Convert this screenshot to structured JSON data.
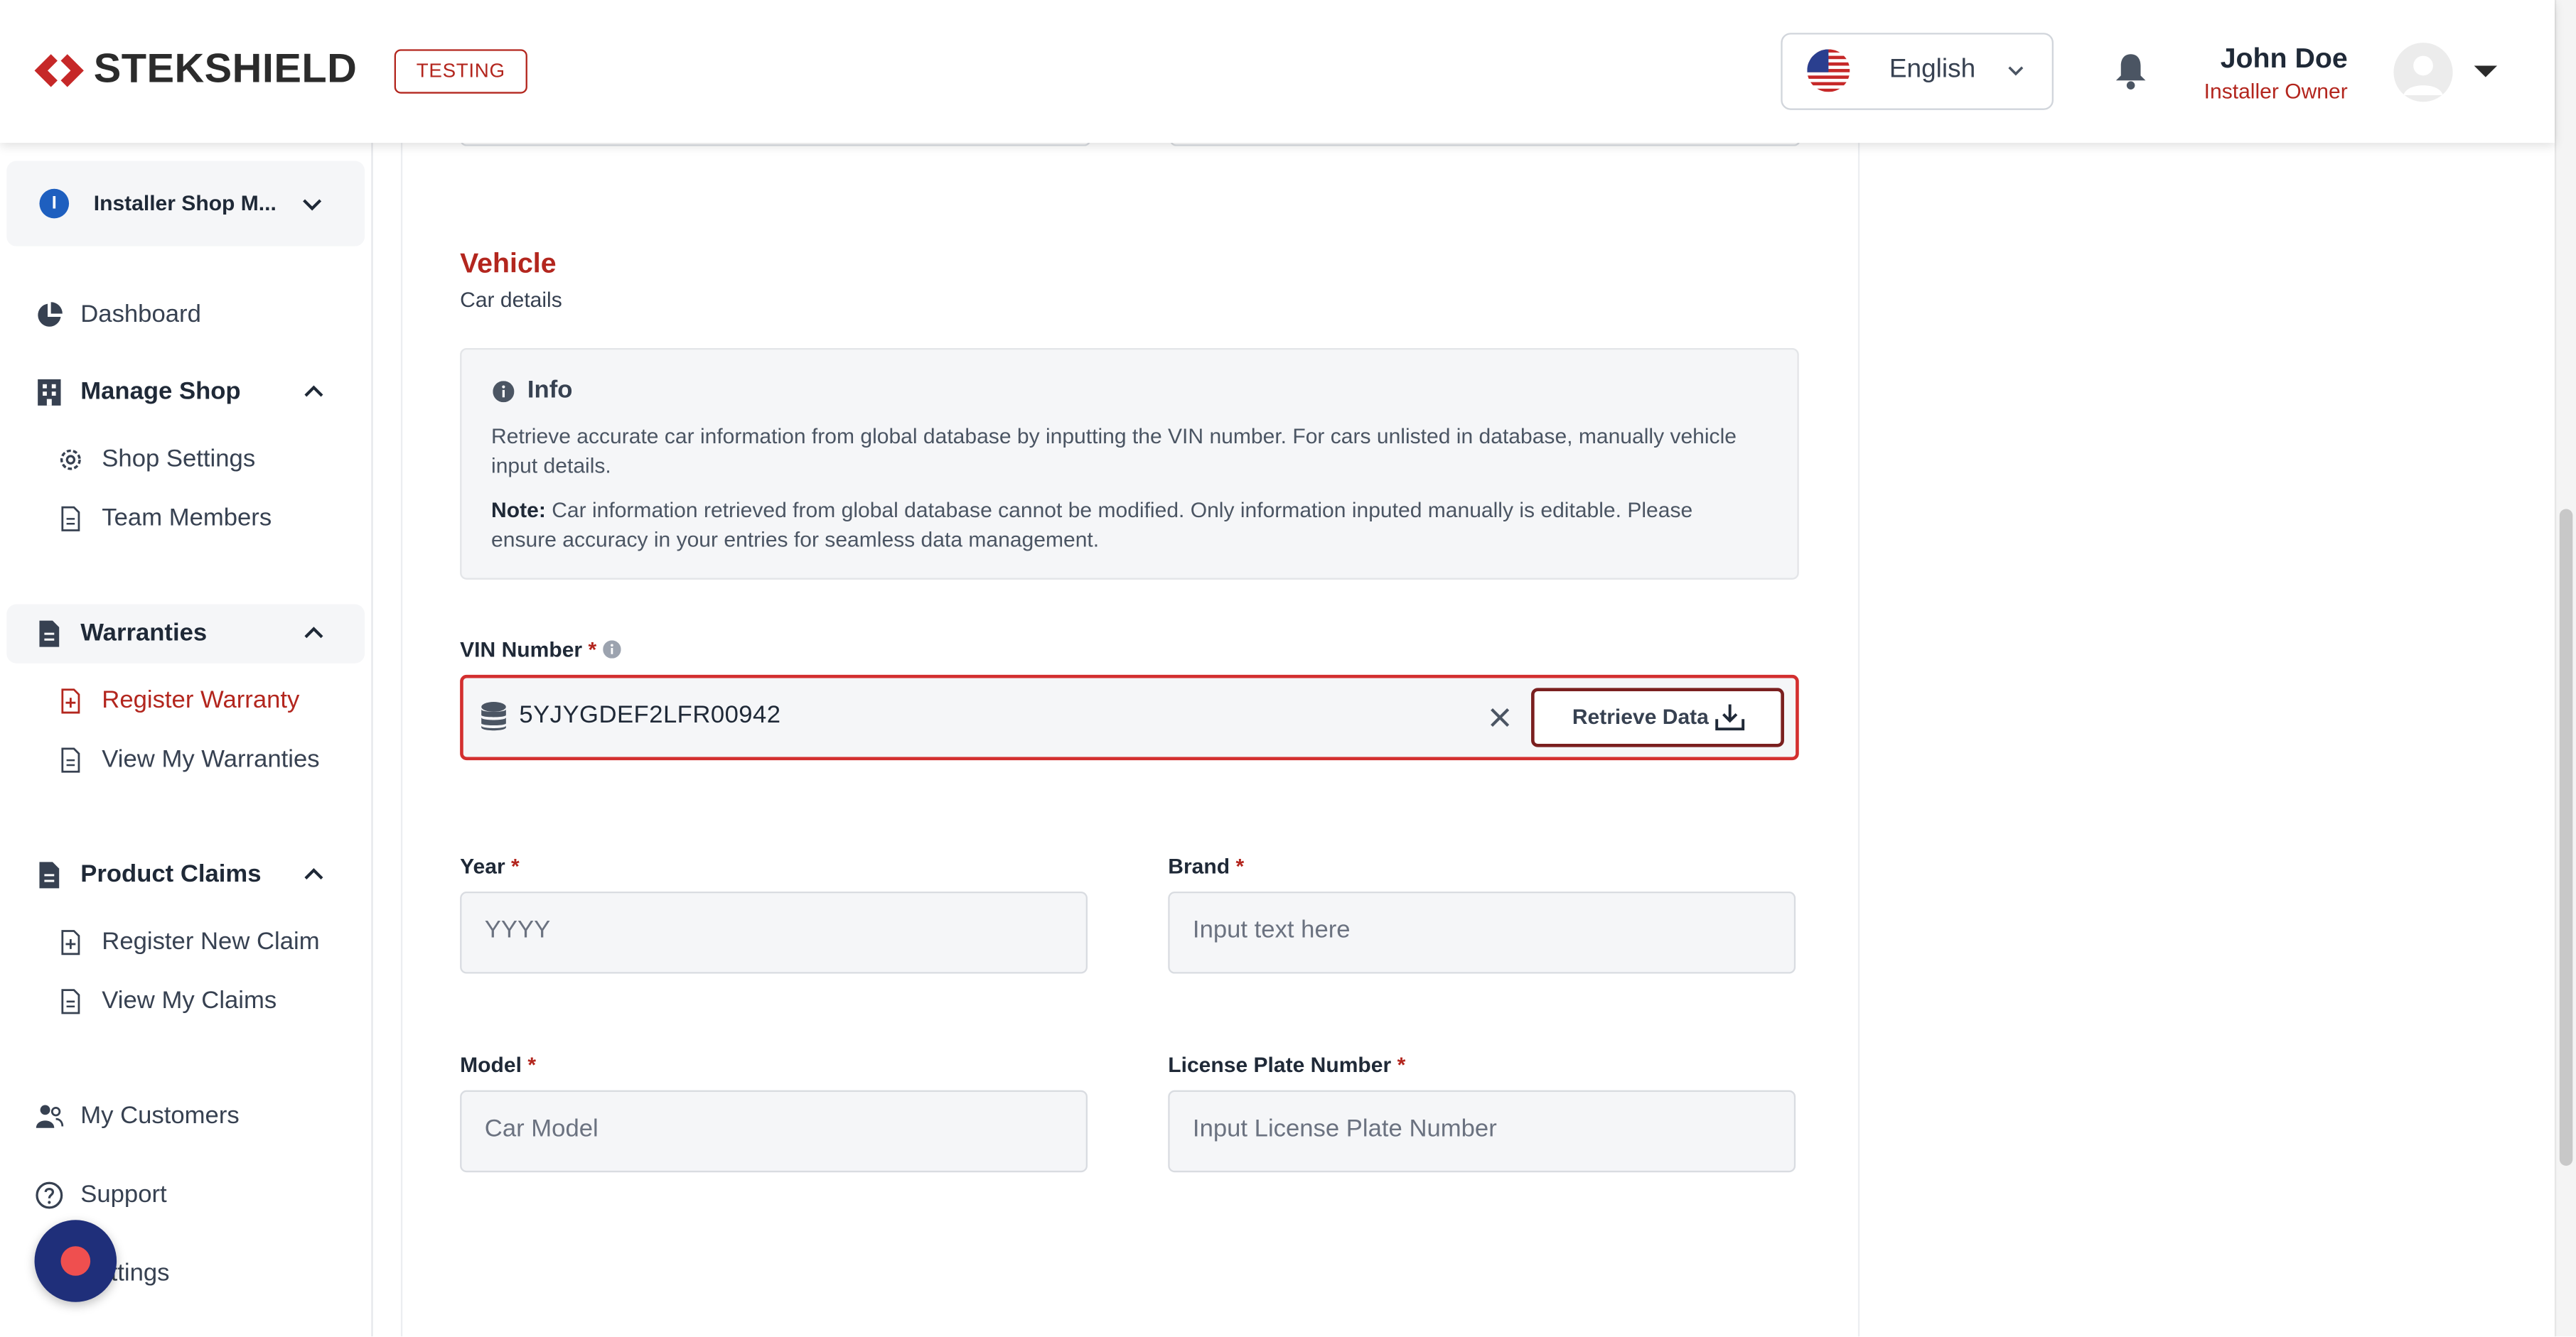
{
  "header": {
    "logo_text": "STEKSHIELD",
    "env_badge": "TESTING",
    "language": "English",
    "user_name": "John Doe",
    "user_role": "Installer Owner"
  },
  "sidebar": {
    "shop_initial": "I",
    "shop_name": "Installer Shop M...",
    "items": {
      "dashboard": "Dashboard",
      "manage_shop": "Manage Shop",
      "shop_settings": "Shop Settings",
      "team_members": "Team Members",
      "warranties": "Warranties",
      "register_warranty": "Register Warranty",
      "view_my_warranties": "View My Warranties",
      "product_claims": "Product Claims",
      "register_new_claim": "Register New Claim",
      "view_my_claims": "View My Claims",
      "my_customers": "My Customers",
      "support": "Support",
      "settings": "Settings"
    }
  },
  "vehicle": {
    "title": "Vehicle",
    "subtitle": "Car details",
    "info": {
      "title": "Info",
      "line1": "Retrieve accurate car information from global database by inputting the VIN number. For cars unlisted in database, manually vehicle input details.",
      "note_label": "Note:",
      "note_text": "Car information retrieved from global database cannot be modified. Only information inputed manually is editable. Please ensure accuracy in your entries for seamless data management."
    },
    "vin": {
      "label": "VIN Number",
      "required": "*",
      "value": "5YJYGDEF2LFR00942",
      "button": "Retrieve Data"
    },
    "year": {
      "label": "Year",
      "required": "*",
      "placeholder": "YYYY"
    },
    "brand": {
      "label": "Brand",
      "required": "*",
      "placeholder": "Input text here"
    },
    "model": {
      "label": "Model",
      "required": "*",
      "placeholder": "Car Model"
    },
    "plate": {
      "label": "License Plate Number",
      "required": "*",
      "placeholder": "Input License Plate Number"
    }
  },
  "colors": {
    "accent": "#b3261e",
    "error_border": "#d32f2f",
    "fab": "#1f2f7a"
  }
}
